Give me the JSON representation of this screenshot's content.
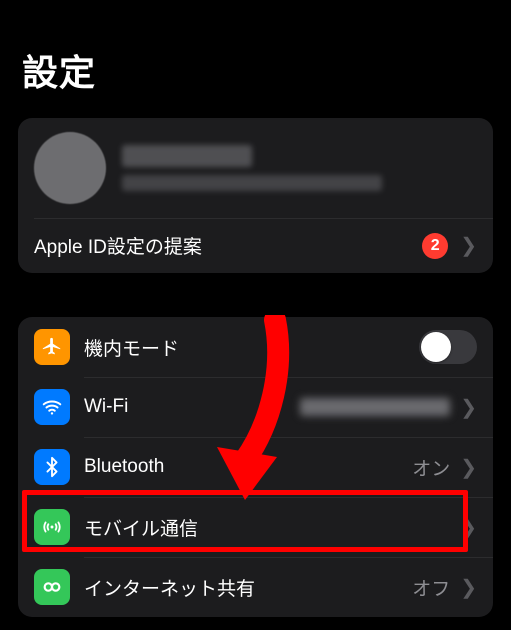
{
  "title": "設定",
  "appleid": {
    "suggestion_label": "Apple ID設定の提案",
    "badge": "2"
  },
  "rows": {
    "airplane": {
      "label": "機内モード"
    },
    "wifi": {
      "label": "Wi-Fi"
    },
    "bluetooth": {
      "label": "Bluetooth",
      "value": "オン"
    },
    "cellular": {
      "label": "モバイル通信"
    },
    "hotspot": {
      "label": "インターネット共有",
      "value": "オフ"
    }
  }
}
